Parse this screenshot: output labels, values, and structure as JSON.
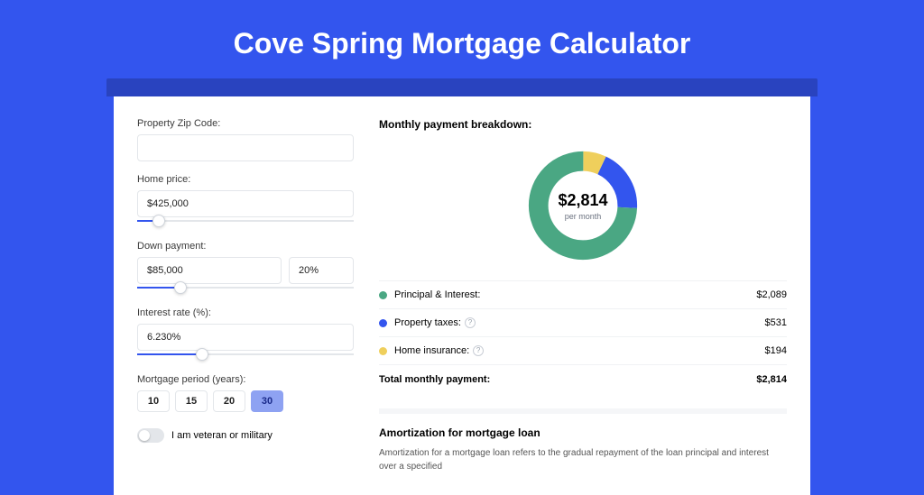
{
  "title": "Cove Spring Mortgage Calculator",
  "form": {
    "zip_label": "Property Zip Code:",
    "zip_value": "",
    "home_price_label": "Home price:",
    "home_price_value": "$425,000",
    "down_payment_label": "Down payment:",
    "down_payment_value": "$85,000",
    "down_payment_pct": "20%",
    "interest_label": "Interest rate (%):",
    "interest_value": "6.230%",
    "period_label": "Mortgage period (years):",
    "period_options": [
      "10",
      "15",
      "20",
      "30"
    ],
    "period_selected": "30",
    "veteran_label": "I am veteran or military",
    "slider_home_pct": 10,
    "slider_dp_pct": 20,
    "slider_rate_pct": 30
  },
  "breakdown": {
    "title": "Monthly payment breakdown:",
    "center_amount": "$2,814",
    "center_sub": "per month",
    "rows": [
      {
        "label": "Principal & Interest:",
        "value": "$2,089",
        "color": "#4aa783",
        "help": false
      },
      {
        "label": "Property taxes:",
        "value": "$531",
        "color": "#3355ee",
        "help": true
      },
      {
        "label": "Home insurance:",
        "value": "$194",
        "color": "#efcf5c",
        "help": true
      }
    ],
    "total_label": "Total monthly payment:",
    "total_value": "$2,814"
  },
  "amort": {
    "title": "Amortization for mortgage loan",
    "text": "Amortization for a mortgage loan refers to the gradual repayment of the loan principal and interest over a specified"
  },
  "chart_data": {
    "type": "pie",
    "title": "Monthly payment breakdown",
    "series": [
      {
        "name": "Principal & Interest",
        "value": 2089,
        "color": "#4aa783"
      },
      {
        "name": "Property taxes",
        "value": 531,
        "color": "#3355ee"
      },
      {
        "name": "Home insurance",
        "value": 194,
        "color": "#efcf5c"
      }
    ],
    "total": 2814,
    "unit": "$ per month"
  }
}
